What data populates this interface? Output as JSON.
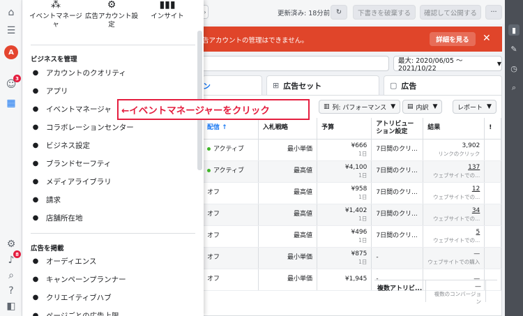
{
  "colors": {
    "accent": "#1877f2",
    "alert_bg": "#e0452a",
    "annotation": "#e41e3f",
    "active_dot": "#42b72a"
  },
  "left_rail": {
    "icons": [
      "home-icon",
      "menu-icon",
      "avatar",
      "notifications-icon",
      "grid-icon",
      "settings-icon",
      "bell-icon",
      "search-icon",
      "help-icon",
      "panel-icon"
    ],
    "avatar_letter": "A",
    "notification_badge": "3",
    "bell_badge": "8"
  },
  "topbar": {
    "updated": "更新済み: 18分前",
    "discard_label": "下書きを破棄する",
    "publish_label": "確認して公開する",
    "more_label": "···"
  },
  "alert": {
    "text": "告アカウントの管理はできません。",
    "detail_label": "詳細を見る",
    "close_label": "✕"
  },
  "date_range": "最大: 2020/06/05 〜 2021/10/22",
  "tabs": [
    {
      "label": "ン"
    },
    {
      "label": "広告セット"
    },
    {
      "label": "広告"
    }
  ],
  "toolbar": {
    "columns_label": "列: パフォーマンス",
    "breakdown_label": "内訳",
    "report_label": "レポート"
  },
  "table": {
    "headers": [
      "配信 ↑",
      "入札戦略",
      "予算",
      "アトリビューション設定",
      "結果",
      "!"
    ],
    "rows": [
      {
        "status": "アクティブ",
        "active": true,
        "bid": "最小単価",
        "budget": "¥666",
        "budget_sub": "1日",
        "attr": "7日間のクリ...",
        "result": "3,902",
        "result_sub": "リンクのクリック"
      },
      {
        "status": "アクティブ",
        "active": true,
        "bid": "最高値",
        "budget": "¥4,100",
        "budget_sub": "1日",
        "attr": "7日間のクリ...",
        "result": "137",
        "result_sub": "ウェブサイトでの..."
      },
      {
        "status": "オフ",
        "active": false,
        "bid": "最高値",
        "budget": "¥958",
        "budget_sub": "1日",
        "attr": "7日間のクリ...",
        "result": "12",
        "result_sub": "ウェブサイトでの..."
      },
      {
        "status": "オフ",
        "active": false,
        "bid": "最高値",
        "budget": "¥1,402",
        "budget_sub": "1日",
        "attr": "7日間のクリ...",
        "result": "34",
        "result_sub": "ウェブサイトでの..."
      },
      {
        "status": "オフ",
        "active": false,
        "bid": "最高値",
        "budget": "¥496",
        "budget_sub": "1日",
        "attr": "7日間のクリ...",
        "result": "5",
        "result_sub": "ウェブサイトでの..."
      },
      {
        "status": "オフ",
        "active": false,
        "bid": "最小単価",
        "budget": "¥875",
        "budget_sub": "1日",
        "attr": "-",
        "result": "—",
        "result_sub": "ウェブサイトでの購入"
      },
      {
        "status": "オフ",
        "active": false,
        "bid": "最小単価",
        "budget": "¥1,945",
        "budget_sub": "",
        "attr": "-",
        "result": "—",
        "result_sub": ""
      }
    ],
    "summary_label": "複数アトリビ...",
    "summary_value": "—",
    "summary_sub": "複数のコンバージョン"
  },
  "menu": {
    "quick": [
      {
        "label": "イベントマネージャ",
        "icon": "event-manager-icon"
      },
      {
        "label": "広告アカウント設定",
        "icon": "ad-account-settings-icon"
      },
      {
        "label": "インサイト",
        "icon": "insights-icon"
      }
    ],
    "section1": "ビジネスを管理",
    "manage": [
      {
        "label": "アカウントのクオリティ",
        "icon": "shield-icon"
      },
      {
        "label": "アプリ",
        "icon": "cube-icon"
      },
      {
        "label": "イベントマネージャ",
        "icon": "event-manager-icon"
      },
      {
        "label": "コラボレーションセンター",
        "icon": "handshake-icon"
      },
      {
        "label": "ビジネス設定",
        "icon": "gear-icon"
      },
      {
        "label": "ブランドセーフティ",
        "icon": "shield-check-icon"
      },
      {
        "label": "メディアライブラリ",
        "icon": "media-icon"
      },
      {
        "label": "請求",
        "icon": "billing-icon"
      },
      {
        "label": "店舗所在地",
        "icon": "location-icon"
      }
    ],
    "section2": "広告を掲載",
    "advertise": [
      {
        "label": "オーディエンス",
        "icon": "audience-icon"
      },
      {
        "label": "キャンペーンプランナー",
        "icon": "planner-icon"
      },
      {
        "label": "クリエイティブハブ",
        "icon": "creative-hub-icon"
      },
      {
        "label": "ページごとの広告上限",
        "icon": "page-limit-icon"
      }
    ]
  },
  "annotation": "←イベントマネージャーをクリック"
}
